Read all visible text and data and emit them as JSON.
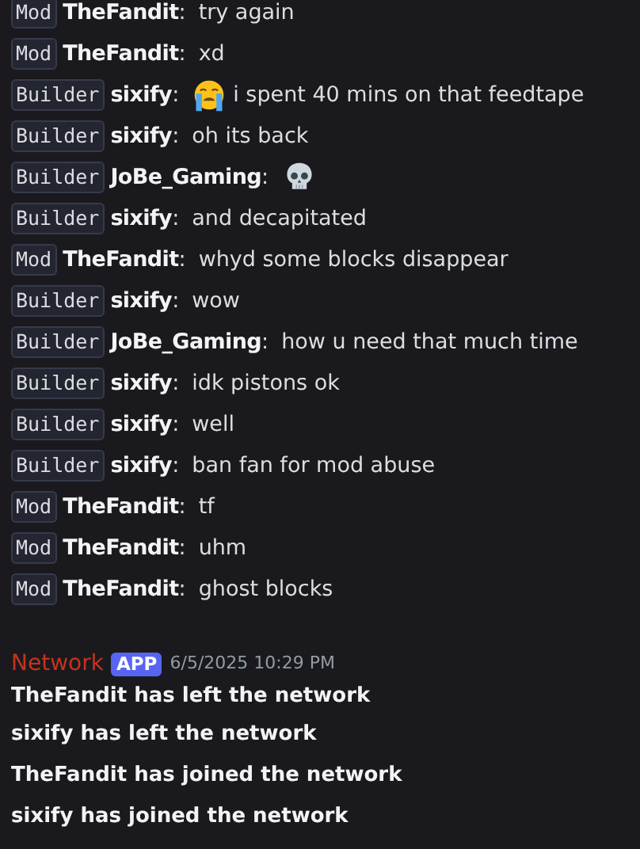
{
  "messages": [
    {
      "tag": "Mod",
      "user": "TheFandit",
      "sep": ":",
      "text": "try again"
    },
    {
      "tag": "Mod",
      "user": "TheFandit",
      "sep": ":",
      "text": "xd"
    },
    {
      "tag": "Builder",
      "user": "sixify",
      "sep": ":",
      "text": "i spent 40 mins on that feedtape",
      "kind": "crying"
    },
    {
      "tag": "Builder",
      "user": "sixify",
      "sep": ":",
      "text": "oh its back"
    },
    {
      "tag": "Builder",
      "user": "JoBe_Gaming",
      "sep": ":",
      "kind": "skull"
    },
    {
      "tag": "Builder",
      "user": "sixify",
      "sep": ":",
      "text": "and decapitated"
    },
    {
      "tag": "Mod",
      "user": "TheFandit",
      "sep": ":",
      "text": "whyd some blocks disappear"
    },
    {
      "tag": "Builder",
      "user": "sixify",
      "sep": ":",
      "text": "wow"
    },
    {
      "tag": "Builder",
      "user": "JoBe_Gaming",
      "sep": ":",
      "text": "how u need that much time"
    },
    {
      "tag": "Builder",
      "user": "sixify",
      "sep": ":",
      "text": "idk pistons ok"
    },
    {
      "tag": "Builder",
      "user": "sixify",
      "sep": ":",
      "text": "well"
    },
    {
      "tag": "Builder",
      "user": "sixify",
      "sep": ":",
      "text": "ban fan for mod abuse"
    },
    {
      "tag": "Mod",
      "user": "TheFandit",
      "sep": ":",
      "text": "tf"
    },
    {
      "tag": "Mod",
      "user": "TheFandit",
      "sep": ":",
      "text": "uhm"
    },
    {
      "tag": "Mod",
      "user": "TheFandit",
      "sep": ":",
      "text": "ghost blocks"
    }
  ],
  "bot_post": {
    "author": "Network",
    "badge": "APP",
    "timestamp": "6/5/2025 10:29 PM",
    "lines": [
      "TheFandit has left the network",
      "sixify has left the network",
      "TheFandit has joined the network",
      "sixify has joined the network"
    ]
  }
}
